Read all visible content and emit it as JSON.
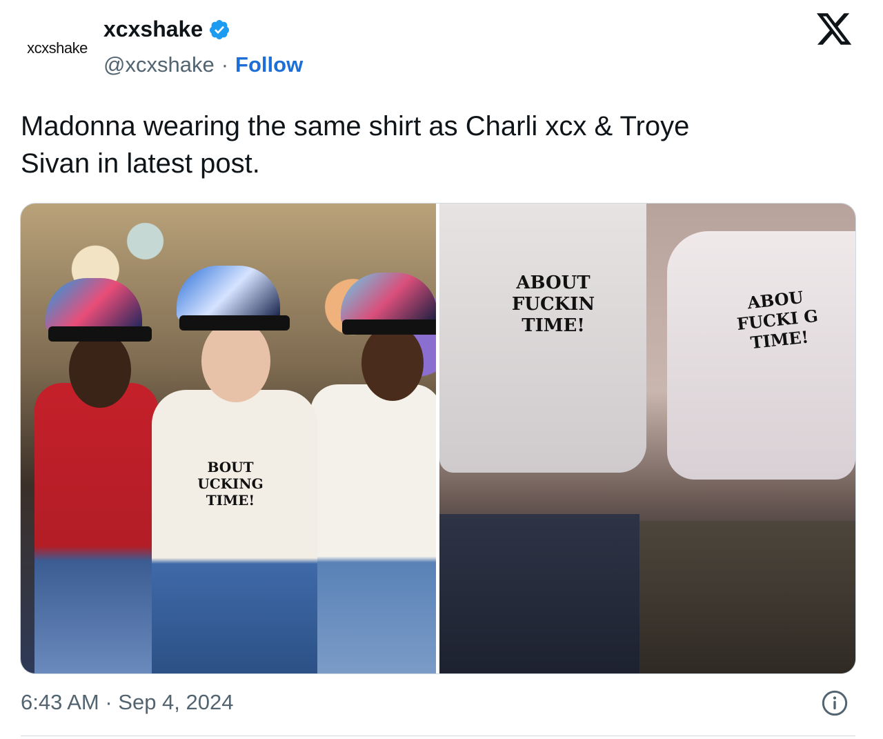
{
  "author": {
    "avatar_text": "xcxshake",
    "display_name": "xcxshake",
    "handle": "@xcxshake",
    "separator": "·",
    "follow_label": "Follow",
    "verified": true
  },
  "brand": {
    "logo_icon": "x-logo-icon"
  },
  "tweet": {
    "text": "Madonna wearing the same shirt as Charli xcx & Troye\nSivan in latest post."
  },
  "media": {
    "left_shirt_text": "BOUT\nUCKING\nTIME!",
    "right_shirt_text_1": "ABOUT\nFUCKIN\nTIME!",
    "right_shirt_text_2": "ABOU\nFUCKI G\nTIME!"
  },
  "footer": {
    "timestamp": "6:43 AM · Sep 4, 2024",
    "info_icon": "info-icon"
  },
  "colors": {
    "link": "#1d6fd8",
    "secondary_text": "#536471",
    "verified_badge": "#1d9bf0",
    "border": "#cfd9de"
  }
}
